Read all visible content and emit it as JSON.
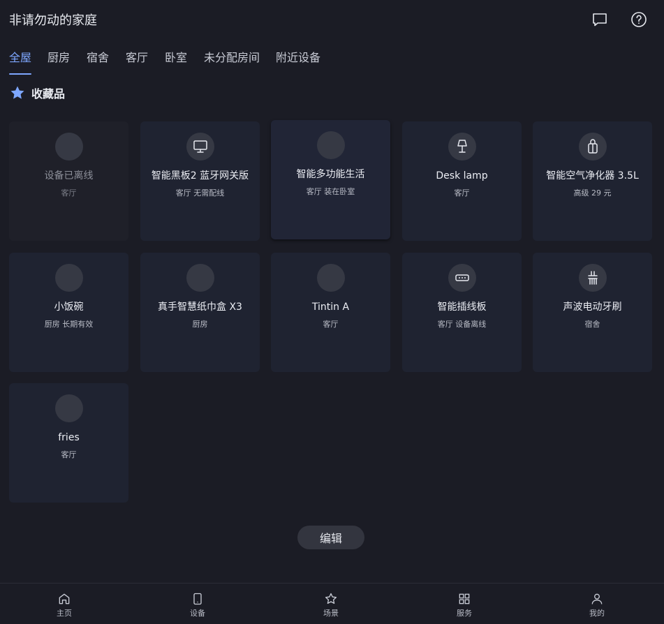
{
  "header": {
    "title": "非请勿动的家庭",
    "icons": [
      "chat-icon",
      "help-icon"
    ]
  },
  "tabs": [
    {
      "label": "全屋",
      "active": true
    },
    {
      "label": "厨房",
      "active": false
    },
    {
      "label": "宿舍",
      "active": false
    },
    {
      "label": "客厅",
      "active": false
    },
    {
      "label": "卧室",
      "active": false
    },
    {
      "label": "未分配房间",
      "active": false
    },
    {
      "label": "附近设备",
      "active": false
    }
  ],
  "favorites": {
    "label": "收藏品",
    "icon": "star-icon"
  },
  "devices": [
    {
      "name": "设备已离线",
      "sub": "客厅",
      "icon": "blank",
      "offline": true
    },
    {
      "name": "智能黑板2 蓝牙网关版",
      "sub": "客厅 无需配线",
      "icon": "monitor-icon"
    },
    {
      "name": "智能多功能生活",
      "sub": "客厅 装在卧室",
      "icon": "blank"
    },
    {
      "name": "Desk lamp",
      "sub": "客厅",
      "icon": "lamp-icon"
    },
    {
      "name": "智能空气净化器 3.5L",
      "sub": "高级 29 元",
      "icon": "purifier-icon"
    },
    {
      "name": "小饭碗",
      "sub": "厨房 长期有效",
      "icon": "blank"
    },
    {
      "name": "真手智慧纸巾盒 X3",
      "sub": "厨房",
      "icon": "blank"
    },
    {
      "name": "Tintin A",
      "sub": "客厅",
      "icon": "blank"
    },
    {
      "name": "智能插线板",
      "sub": "客厅 设备离线",
      "icon": "power-strip-icon"
    },
    {
      "name": "声波电动牙刷",
      "sub": "宿舍",
      "icon": "toothbrush-icon"
    },
    {
      "name": "fries",
      "sub": "客厅",
      "icon": "blank"
    }
  ],
  "edit_label": "编辑",
  "bottom_nav": [
    {
      "label": "主页",
      "icon": "home-icon"
    },
    {
      "label": "设备",
      "icon": "device-icon"
    },
    {
      "label": "场景",
      "icon": "scene-star-icon"
    },
    {
      "label": "服务",
      "icon": "grid-icon"
    },
    {
      "label": "我的",
      "icon": "profile-icon"
    }
  ],
  "colors": {
    "background": "#1b1c25",
    "card": "#1f2331",
    "accent": "#7ea7ff"
  }
}
